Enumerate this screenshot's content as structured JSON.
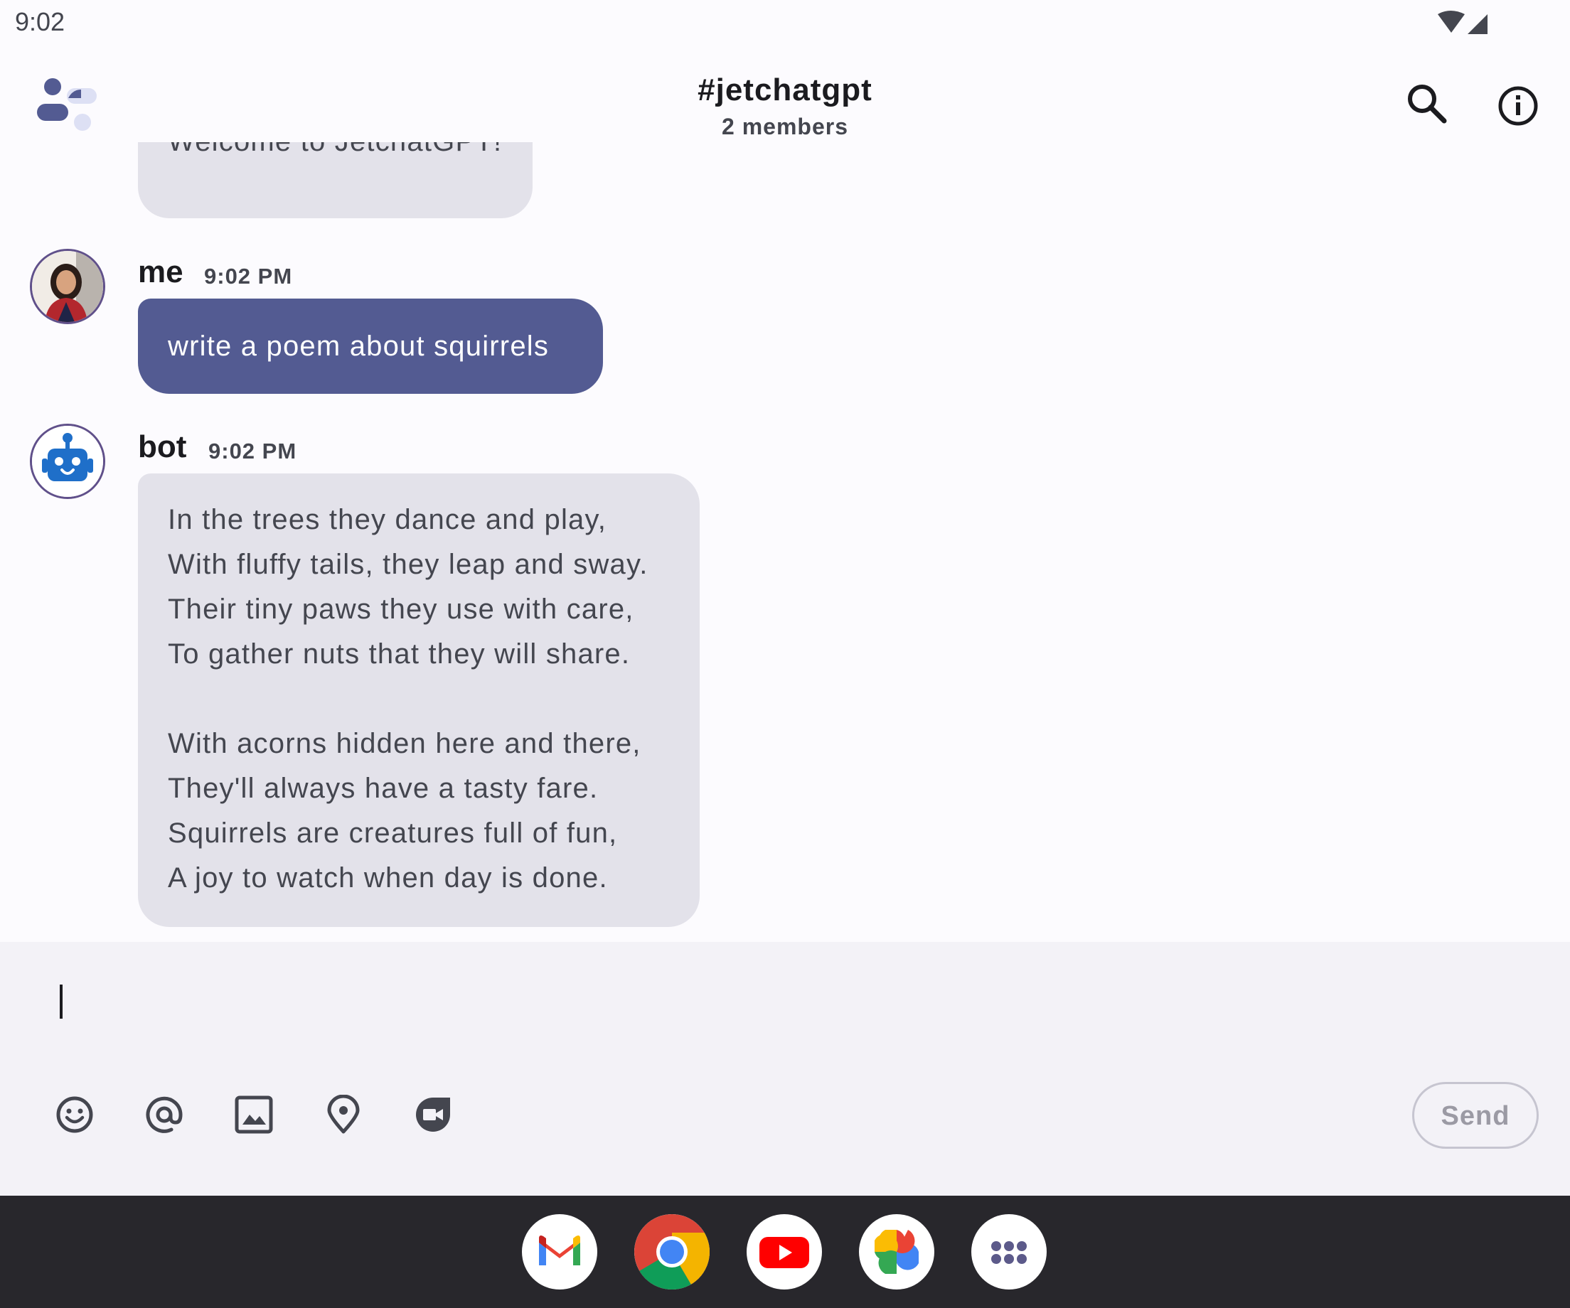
{
  "status_bar": {
    "time": "9:02"
  },
  "header": {
    "title": "#jetchatgpt",
    "members": "2 members"
  },
  "messages": {
    "welcome": "Welcome to JetchatGPT!",
    "me": {
      "author": "me",
      "time": "9:02 PM",
      "text": "write a poem about squirrels"
    },
    "bot": {
      "author": "bot",
      "time": "9:02 PM",
      "lines": [
        "In the trees they dance and play,",
        "With fluffy tails, they leap and sway.",
        "Their tiny paws they use with care,",
        "To gather nuts that they will share.",
        "",
        "With acorns hidden here and there,",
        "They'll always have a tasty fare.",
        "Squirrels are creatures full of fun,",
        "A joy to watch when day is done."
      ]
    }
  },
  "input": {
    "value": "",
    "send_label": "Send"
  },
  "toolbar_icons": [
    "emoji-icon",
    "mention-icon",
    "image-icon",
    "location-icon",
    "video-icon"
  ],
  "dock_apps": [
    "gmail-icon",
    "chrome-icon",
    "youtube-icon",
    "photos-icon",
    "app-drawer-icon"
  ],
  "colors": {
    "me_bubble": "#535b92",
    "bot_bubble": "#e3e2ea",
    "accent": "#535b92"
  }
}
